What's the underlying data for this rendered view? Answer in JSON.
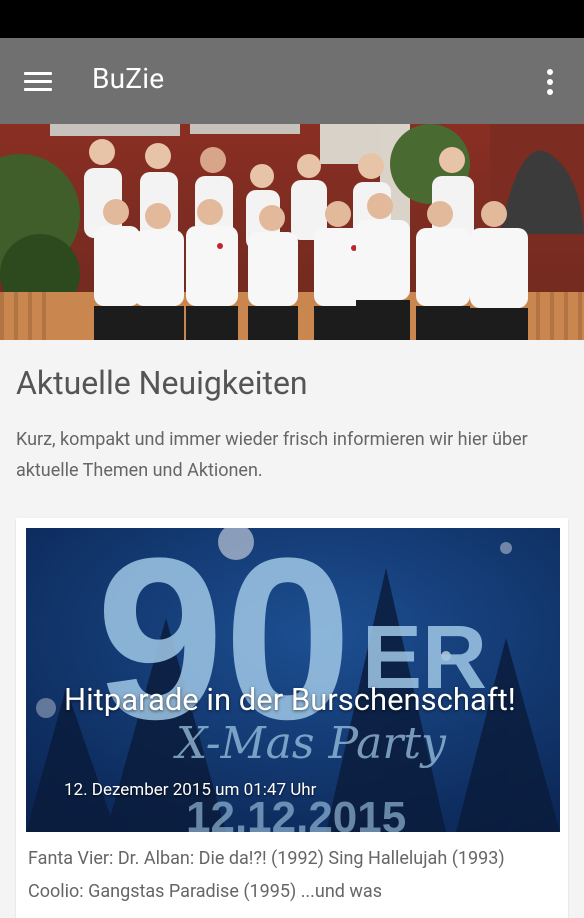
{
  "app": {
    "title": "BuZie"
  },
  "icons": {
    "menu": "hamburger-menu-icon",
    "overflow": "more-vert-icon"
  },
  "colors": {
    "appbar": "#707070",
    "statusbar": "#000000",
    "background": "#f4f4f4"
  },
  "hero": {
    "description_icon": "group-photo-image"
  },
  "news": {
    "heading": "Aktuelle Neuigkeiten",
    "intro": "Kurz, kompakt und immer wieder frisch informieren wir hier über aktuelle Themen und Aktionen.",
    "posts": [
      {
        "title": "Hitparade in der Burschenschaft!",
        "date": "12. Dezember 2015 um 01:47 Uhr",
        "excerpt": "Fanta Vier: Dr. Alban: Die da!?! (1992) Sing Hallelujah (1993) Coolio: Gangstas Paradise (1995) ...und was",
        "image_text": {
          "big": "90",
          "suffix": "ER",
          "script": "X-Mas Party",
          "date": "12.12.2015"
        }
      }
    ]
  }
}
